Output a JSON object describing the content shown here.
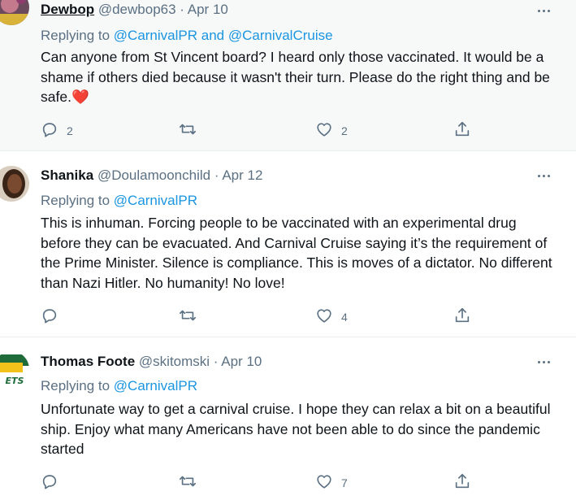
{
  "tweets": [
    {
      "name": "Dewbop",
      "handle": "@dewbop63",
      "sep": "·",
      "date": "Apr 10",
      "replying_prefix": "Replying to ",
      "mention1": "@CarnivalPR",
      "replying_join": " and ",
      "mention2": "@CarnivalCruise",
      "text": "Can anyone from St Vincent board? I heard only those vaccinated. It would be a shame if others died because it wasn't their turn. Please do the right thing and be safe.",
      "emoji": "❤️",
      "replies": "2",
      "retweets": "",
      "likes": "2"
    },
    {
      "name": "Shanika",
      "handle": "@Doulamoonchild",
      "sep": "·",
      "date": "Apr 12",
      "replying_prefix": "Replying to ",
      "mention1": "@CarnivalPR",
      "text": "This is inhuman. Forcing people to be vaccinated with an experimental drug before they can be evacuated. And Carnival Cruise saying it’s the requirement of the Prime Minister. Silence is compliance. This is moves of a dictator. No different than Nazi Hitler. No humanity! No love!",
      "replies": "",
      "retweets": "",
      "likes": "4"
    },
    {
      "name": "Thomas Foote",
      "handle": "@skitomski",
      "sep": "·",
      "date": "Apr 10",
      "replying_prefix": "Replying to ",
      "mention1": "@CarnivalPR",
      "text": "Unfortunate way to get a carnival cruise.  I hope they can relax a bit on a beautiful ship.  Enjoy what many Americans have not been able to do since the pandemic started",
      "avatar_text": "ETS",
      "replies": "",
      "retweets": "",
      "likes": "7"
    }
  ],
  "icons": [
    "reply-icon",
    "retweet-icon",
    "like-icon",
    "share-icon",
    "more-icon"
  ],
  "colors": {
    "text": "#0f1419",
    "secondary": "#5b7083",
    "link": "#1b95e0",
    "highlight_bg": "#f7f9f9",
    "divider": "#ebeef0"
  }
}
